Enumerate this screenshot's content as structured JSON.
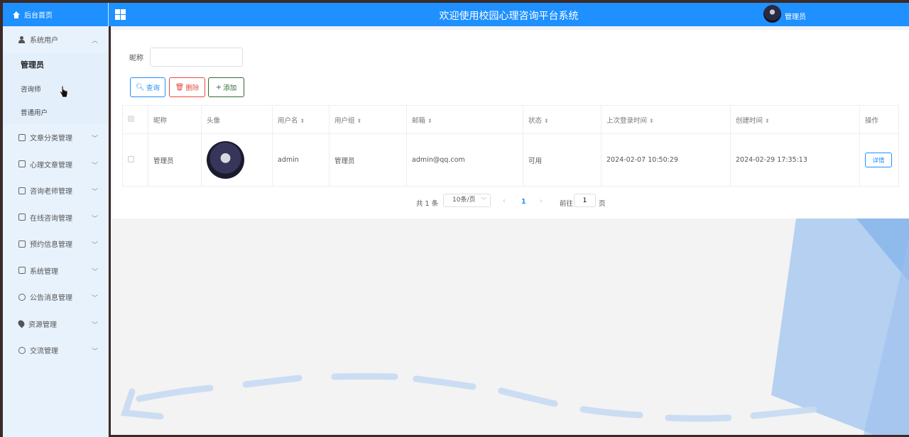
{
  "header": {
    "title": "欢迎使用校园心理咨询平台系统",
    "username": "管理员"
  },
  "sidebar": {
    "home": "后台首页",
    "groups": [
      {
        "label": "系统用户",
        "expanded": true,
        "children": [
          "管理员",
          "咨询师",
          "普通用户"
        ],
        "active_child": "管理员"
      },
      {
        "label": "文章分类管理"
      },
      {
        "label": "心理文章管理"
      },
      {
        "label": "咨询老师管理"
      },
      {
        "label": "在线咨询管理"
      },
      {
        "label": "预约信息管理"
      },
      {
        "label": "系统管理"
      },
      {
        "label": "公告消息管理"
      },
      {
        "label": "资源管理"
      },
      {
        "label": "交流管理"
      }
    ]
  },
  "search": {
    "label": "昵称",
    "value": "",
    "placeholder": ""
  },
  "toolbar": {
    "query_label": "查询",
    "delete_label": "删除",
    "add_label": "添加"
  },
  "table": {
    "columns": [
      "昵称",
      "头像",
      "用户名",
      "用户组",
      "邮箱",
      "状态",
      "上次登录时间",
      "创建时间",
      "操作"
    ],
    "rows": [
      {
        "nickname": "管理员",
        "username": "admin",
        "group": "管理员",
        "email": "admin@qq.com",
        "status": "可用",
        "last_login": "2024-02-07 10:50:29",
        "created": "2024-02-29 17:35:13",
        "action": "详情"
      }
    ]
  },
  "pagination": {
    "total_text": "共 1 条",
    "page_size": "10条/页",
    "current_page": "1",
    "goto_label": "前往",
    "goto_value": "1",
    "page_unit": "页"
  },
  "colors": {
    "primary": "#1e90ff",
    "danger": "#e64a3c",
    "success": "#2e6b2e",
    "sidebar_bg": "#e8f2fc"
  }
}
